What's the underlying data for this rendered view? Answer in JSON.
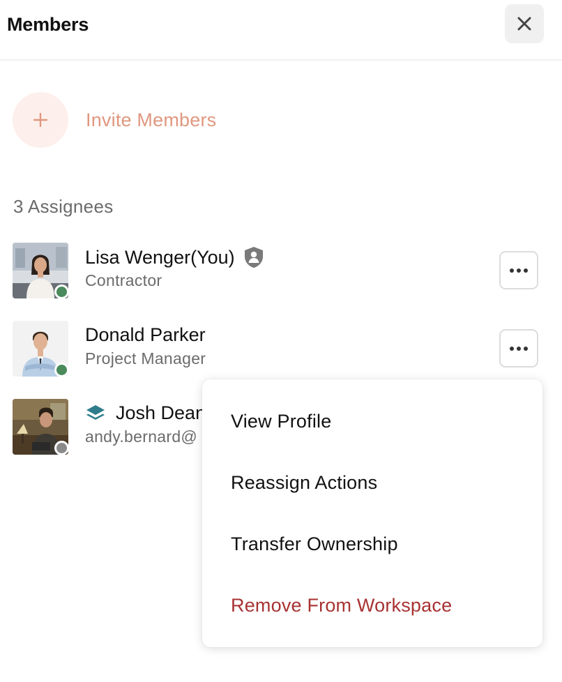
{
  "header": {
    "title": "Members"
  },
  "invite": {
    "label": "Invite Members"
  },
  "assignees": {
    "title": "3 Assignees",
    "members": [
      {
        "name": "Lisa Wenger(You)",
        "subtitle": "Contractor",
        "status": "online",
        "status_color": "#4a8a5c",
        "badge": "shield-person-icon"
      },
      {
        "name": "Donald Parker",
        "subtitle": "Project Manager",
        "status": "online",
        "status_color": "#4a8a5c"
      },
      {
        "name": "Josh Dean",
        "subtitle": "andy.bernard@",
        "status": "offline",
        "status_color": "#8a8a8a",
        "badge": "layers-icon"
      }
    ]
  },
  "context_menu": {
    "items": [
      {
        "label": "View Profile"
      },
      {
        "label": "Reassign Actions"
      },
      {
        "label": "Transfer Ownership"
      },
      {
        "label": "Remove From Workspace",
        "danger": true
      }
    ]
  },
  "colors": {
    "accent": "#e0977f",
    "accent_bg": "#fdf0ec",
    "danger": "#a83232",
    "muted_text": "#6b6b6b",
    "online": "#4a8a5c",
    "offline": "#8a8a8a",
    "layers_icon": "#2f7d8c"
  }
}
